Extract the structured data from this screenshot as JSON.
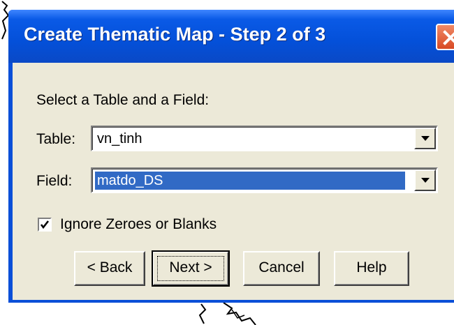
{
  "dialog": {
    "title": "Create Thematic Map - Step 2 of 3",
    "prompt": "Select a Table and a Field:",
    "table_label": "Table:",
    "table_value": "vn_tinh",
    "field_label": "Field:",
    "field_value": "matdo_DS",
    "ignore_label": "Ignore Zeroes or Blanks",
    "ignore_checked": true,
    "buttons": {
      "back": "< Back",
      "next": "Next >",
      "cancel": "Cancel",
      "help": "Help"
    }
  },
  "colors": {
    "titlebar": "#0450d9",
    "client": "#ece9d8",
    "selection": "#316ac5",
    "close": "#d84a24"
  }
}
